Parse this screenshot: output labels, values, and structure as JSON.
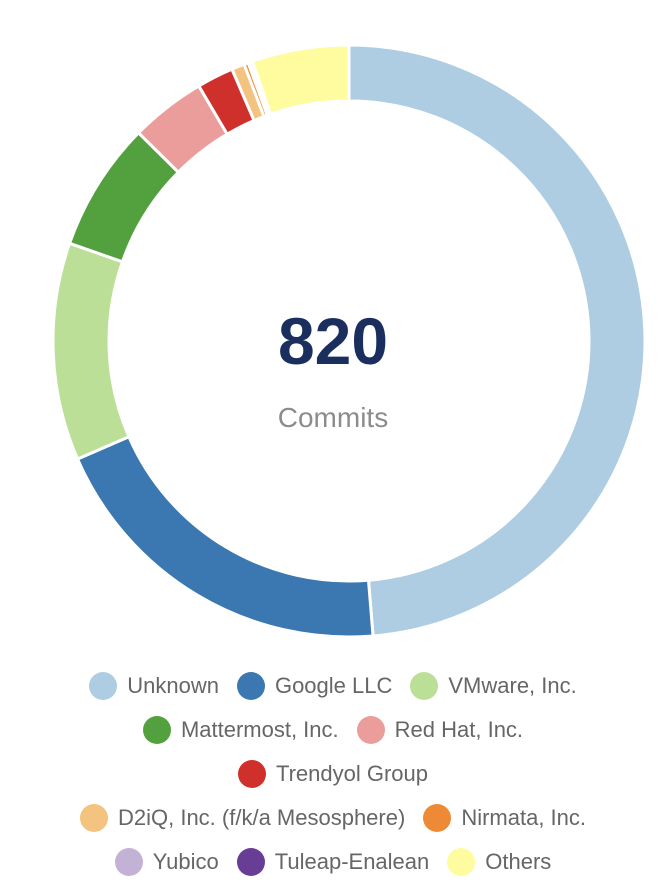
{
  "center": {
    "value": "820",
    "label": "Commits"
  },
  "chart_data": {
    "type": "pie",
    "title": "",
    "total": 820,
    "center_value": "820",
    "center_label": "Commits",
    "legend_position": "bottom",
    "slices": [
      {
        "name": "Unknown",
        "value": 414,
        "color": "#aecde2"
      },
      {
        "name": "Google LLC",
        "value": 168,
        "color": "#3b77b0"
      },
      {
        "name": "VMware, Inc.",
        "value": 101,
        "color": "#bbdf97"
      },
      {
        "name": "Mattermost, Inc.",
        "value": 60,
        "color": "#53a03f"
      },
      {
        "name": "Red Hat, Inc.",
        "value": 35,
        "color": "#eb9d9b"
      },
      {
        "name": "Trendyol Group",
        "value": 17,
        "color": "#d0302b"
      },
      {
        "name": "D2iQ, Inc. (f/k/a Mesosphere)",
        "value": 6,
        "color": "#f3c37f"
      },
      {
        "name": "Nirmata, Inc.",
        "value": 2,
        "color": "#ee8a36"
      },
      {
        "name": "Yubico",
        "value": 1,
        "color": "#c3b2d6"
      },
      {
        "name": "Tuleap-Enalean",
        "value": 1,
        "color": "#673d95"
      },
      {
        "name": "Others",
        "value": 45,
        "color": "#fefc9f"
      }
    ]
  },
  "legend": {
    "rows": [
      [
        0,
        1,
        2
      ],
      [
        3,
        4
      ],
      [
        5
      ],
      [
        6,
        7
      ],
      [
        8,
        9,
        10
      ]
    ]
  }
}
